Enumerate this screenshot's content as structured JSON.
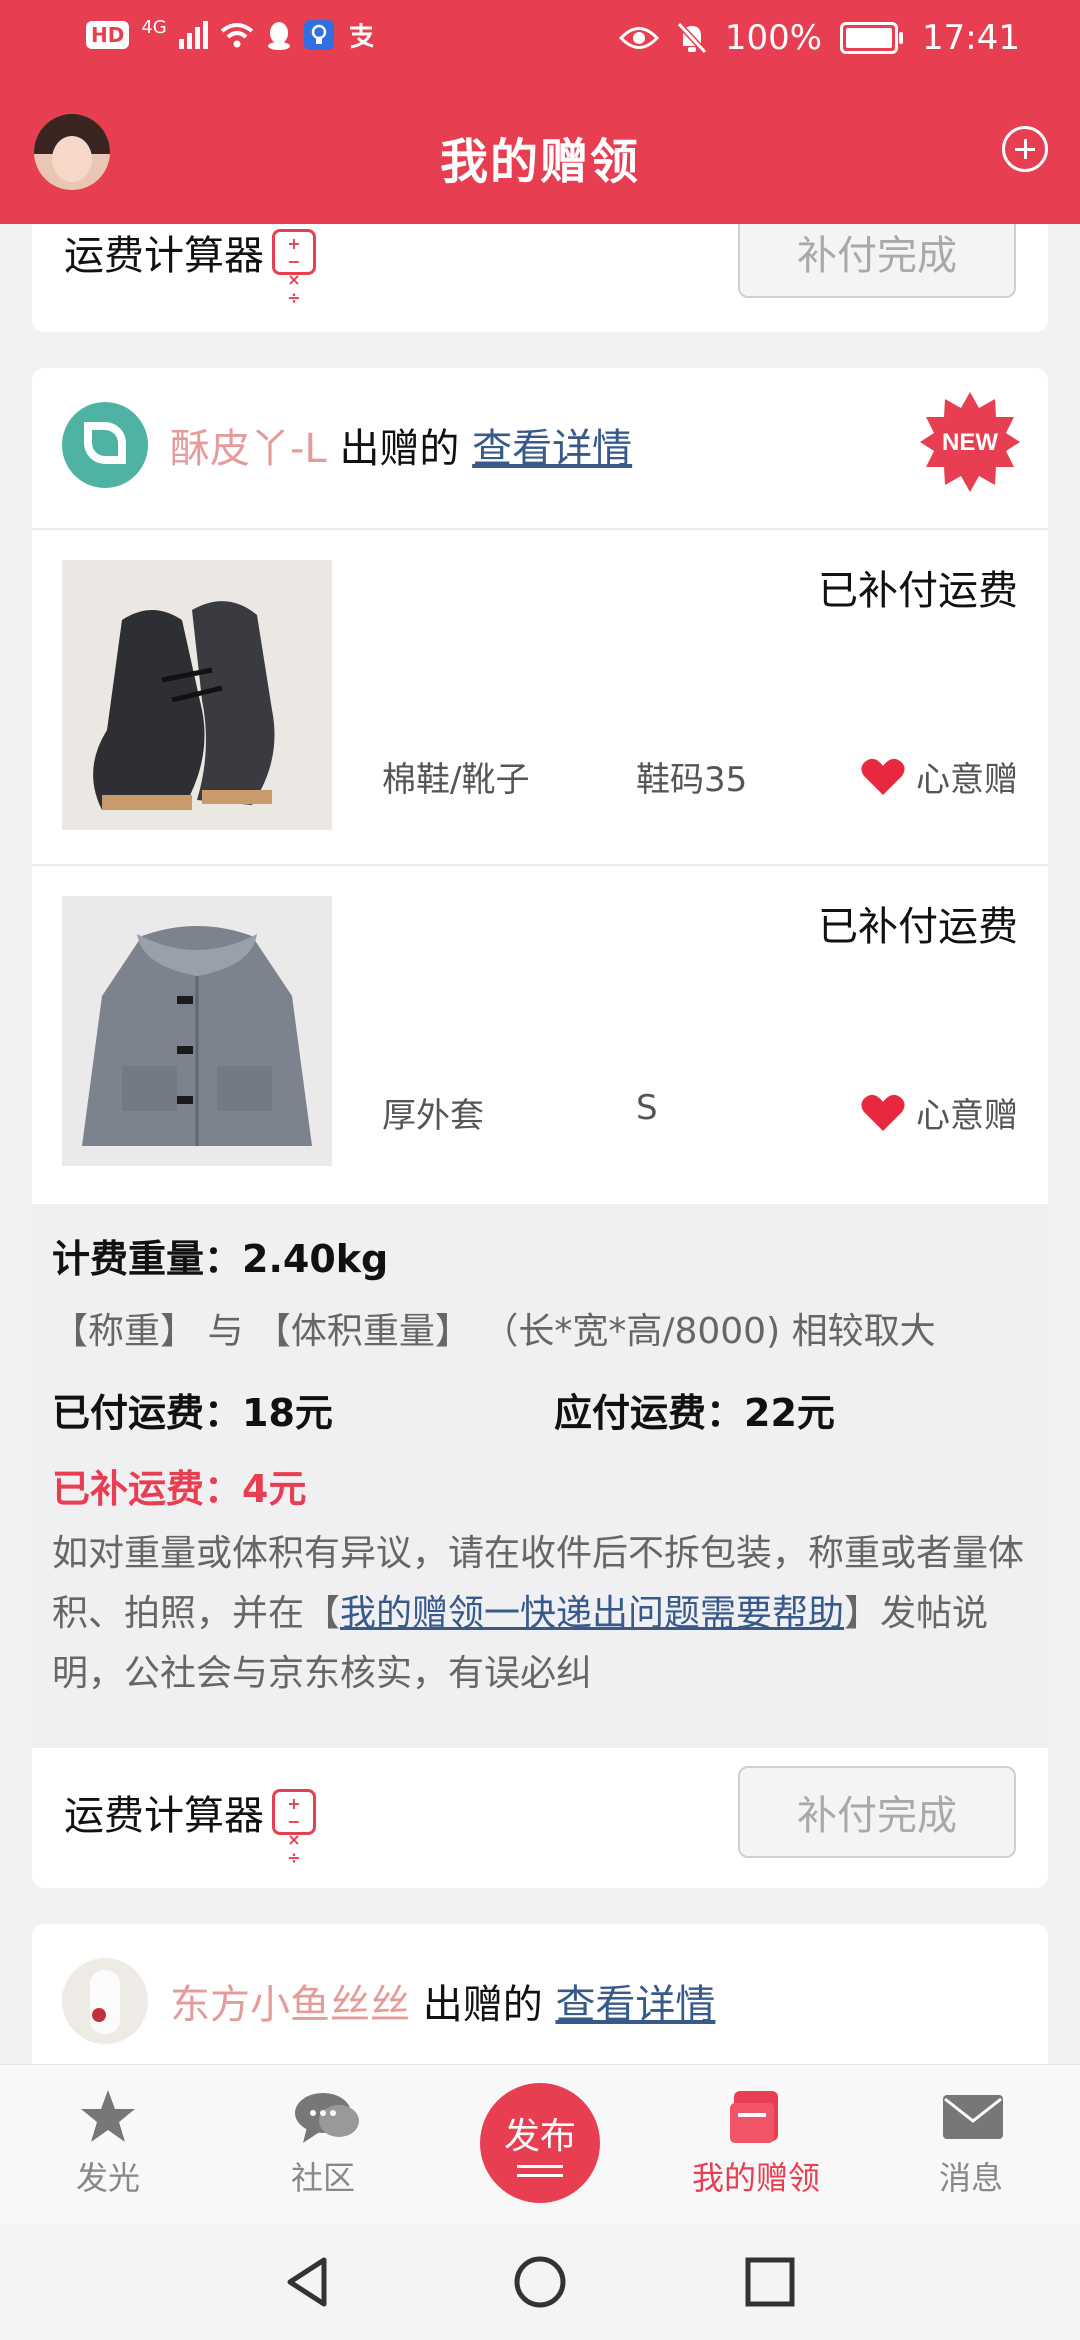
{
  "status_bar": {
    "network": "HD",
    "signal": "4G",
    "battery": "100%",
    "time": "17:41"
  },
  "header": {
    "title": "我的赠领"
  },
  "top_card": {
    "calc_label": "运费计算器",
    "button": "补付完成"
  },
  "card": {
    "giver_name": "酥皮丫-L",
    "giver_suffix": "出赠的",
    "detail_link": "查看详情",
    "badge": "NEW",
    "items": [
      {
        "status": "已补付运费",
        "category": "棉鞋/靴子",
        "size": "鞋码35",
        "gift_label": "心意赠"
      },
      {
        "status": "已补付运费",
        "category": "厚外套",
        "size": "S",
        "gift_label": "心意赠"
      }
    ],
    "fee": {
      "weight": "计费重量：2.40kg",
      "weight_rule": "【称重】 与 【体积重量】 （长*宽*高/8000) 相较取大",
      "paid": "已付运费：18元",
      "due": "应付运费：22元",
      "supplement": "已补运费：4元",
      "note_prefix": "如对重量或体积有异议，请在收件后不拆包装，称重或者量体积、拍照，并在【",
      "note_link": "我的赠领一快递出问题需要帮助",
      "note_suffix": "】发帖说明，公社会与京东核实，有误必纠"
    },
    "calc_label": "运费计算器",
    "button": "补付完成"
  },
  "next_card": {
    "giver_name": "东方小鱼丝丝",
    "giver_suffix": "出赠的",
    "detail_link": "查看详情"
  },
  "tabbar": {
    "tabs": [
      {
        "label": "发光",
        "icon": "star-icon"
      },
      {
        "label": "社区",
        "icon": "chat-icon"
      },
      {
        "label": "发布",
        "icon": "publish-icon"
      },
      {
        "label": "我的赠领",
        "icon": "gift-box-icon"
      },
      {
        "label": "消息",
        "icon": "mail-icon"
      }
    ]
  },
  "colors": {
    "brand": "#e83e51",
    "link": "#375a8a",
    "giver": "#e69b9b"
  }
}
